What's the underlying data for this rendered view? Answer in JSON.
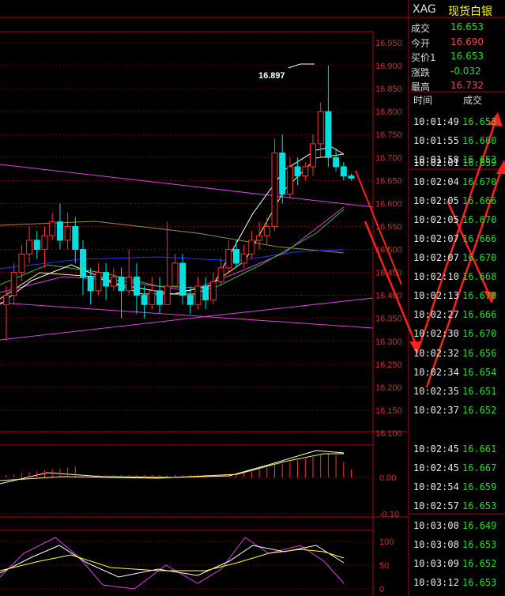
{
  "header": {
    "symbol": "XAG",
    "name": "现货白银"
  },
  "quote": [
    {
      "label": "成交",
      "value": "16.653",
      "color": "#22dd22"
    },
    {
      "label": "今开",
      "value": "16.690",
      "color": "#ff4444"
    },
    {
      "label": "买价1",
      "value": "16.653",
      "color": "#22dd22"
    },
    {
      "label": "涨跌",
      "value": "-0.032",
      "color": "#22dd22"
    },
    {
      "label": "最高",
      "value": "16.732",
      "color": "#ff4444"
    }
  ],
  "ticks_header": {
    "time": "时间",
    "price": "成交"
  },
  "ticks": [
    [
      "10:01:49",
      "16.653"
    ],
    [
      "10:01:55",
      "16.660"
    ],
    [
      "10:01:58",
      "16.653"
    ],
    [
      "10:02:01",
      "16.659"
    ],
    [
      "10:02:04",
      "16.670"
    ],
    [
      "10:02:05",
      "16.666"
    ],
    [
      "10:02:05",
      "16.670"
    ],
    [
      "10:02:07",
      "16.666"
    ],
    [
      "10:02:07",
      "16.670"
    ],
    [
      "10:02:10",
      "16.668"
    ],
    [
      "10:02:13",
      "16.670"
    ],
    [
      "10:02:27",
      "16.666"
    ],
    [
      "10:02:30",
      "16.670"
    ],
    [
      "10:02:32",
      "16.656"
    ],
    [
      "10:02:34",
      "16.654"
    ],
    [
      "10:02:35",
      "16.651"
    ],
    [
      "10:02:37",
      "16.652"
    ],
    [
      "10:02:45",
      "16.661"
    ],
    [
      "10:02:45",
      "16.667"
    ],
    [
      "10:02:54",
      "16.659"
    ],
    [
      "10:02:57",
      "16.653"
    ],
    [
      "10:03:00",
      "16.649"
    ],
    [
      "10:03:08",
      "16.653"
    ],
    [
      "10:03:09",
      "16.652"
    ],
    [
      "10:03:12",
      "16.653"
    ]
  ],
  "chart_data": {
    "type": "candlestick",
    "main_axis": {
      "ylim": [
        16.1,
        16.97
      ],
      "tick_labels": [
        "16.950",
        "16.900",
        "16.850",
        "16.800",
        "16.750",
        "16.700",
        "16.650",
        "16.600",
        "16.550",
        "16.500",
        "16.450",
        "16.400",
        "16.350",
        "16.300",
        "16.250",
        "16.200",
        "16.150",
        "16.100"
      ]
    },
    "annotation": "16.897",
    "candles": [
      [
        16.38,
        16.4,
        16.3,
        16.42
      ],
      [
        16.4,
        16.45,
        16.38,
        16.47
      ],
      [
        16.45,
        16.49,
        16.43,
        16.51
      ],
      [
        16.49,
        16.52,
        16.47,
        16.55
      ],
      [
        16.52,
        16.5,
        16.48,
        16.54
      ],
      [
        16.5,
        16.53,
        16.46,
        16.55
      ],
      [
        16.53,
        16.56,
        16.52,
        16.58
      ],
      [
        16.56,
        16.52,
        16.5,
        16.6
      ],
      [
        16.52,
        16.55,
        16.5,
        16.58
      ],
      [
        16.55,
        16.5,
        16.47,
        16.57
      ],
      [
        16.5,
        16.44,
        16.4,
        16.52
      ],
      [
        16.44,
        16.41,
        16.38,
        16.46
      ],
      [
        16.41,
        16.45,
        16.4,
        16.47
      ],
      [
        16.45,
        16.42,
        16.39,
        16.47
      ],
      [
        16.42,
        16.44,
        16.41,
        16.46
      ],
      [
        16.44,
        16.41,
        16.35,
        16.46
      ],
      [
        16.41,
        16.44,
        16.4,
        16.5
      ],
      [
        16.44,
        16.4,
        16.36,
        16.47
      ],
      [
        16.4,
        16.38,
        16.35,
        16.42
      ],
      [
        16.38,
        16.41,
        16.37,
        16.44
      ],
      [
        16.41,
        16.38,
        16.36,
        16.44
      ],
      [
        16.38,
        16.42,
        16.38,
        16.56
      ],
      [
        16.42,
        16.47,
        16.42,
        16.49
      ],
      [
        16.47,
        16.4,
        16.38,
        16.49
      ],
      [
        16.4,
        16.38,
        16.36,
        16.42
      ],
      [
        16.38,
        16.42,
        16.37,
        16.44
      ],
      [
        16.42,
        16.39,
        16.37,
        16.44
      ],
      [
        16.39,
        16.43,
        16.38,
        16.45
      ],
      [
        16.43,
        16.46,
        16.42,
        16.48
      ],
      [
        16.46,
        16.5,
        16.45,
        16.52
      ],
      [
        16.5,
        16.47,
        16.46,
        16.52
      ],
      [
        16.47,
        16.49,
        16.46,
        16.51
      ],
      [
        16.49,
        16.52,
        16.48,
        16.54
      ],
      [
        16.52,
        16.53,
        16.5,
        16.56
      ],
      [
        16.53,
        16.55,
        16.51,
        16.57
      ],
      [
        16.55,
        16.71,
        16.54,
        16.74
      ],
      [
        16.71,
        16.62,
        16.6,
        16.75
      ],
      [
        16.62,
        16.68,
        16.61,
        16.7
      ],
      [
        16.68,
        16.66,
        16.64,
        16.7
      ],
      [
        16.66,
        16.68,
        16.65,
        16.69
      ],
      [
        16.68,
        16.73,
        16.66,
        16.75
      ],
      [
        16.73,
        16.8,
        16.7,
        16.82
      ],
      [
        16.8,
        16.7,
        16.68,
        16.9
      ],
      [
        16.7,
        16.68,
        16.67,
        16.72
      ],
      [
        16.68,
        16.66,
        16.65,
        16.69
      ],
      [
        16.66,
        16.655,
        16.65,
        16.665
      ]
    ],
    "macd_axis": {
      "tick_labels": [
        "0.00",
        "-0.10"
      ]
    },
    "kdj_axis": {
      "tick_labels": [
        "100",
        "50",
        "0"
      ]
    }
  }
}
